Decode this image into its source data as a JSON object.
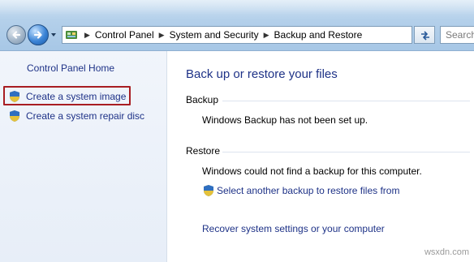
{
  "nav": {
    "back_icon": "back-arrow-icon",
    "forward_icon": "forward-arrow-icon"
  },
  "address": {
    "crumbs": [
      "Control Panel",
      "System and Security",
      "Backup and Restore"
    ]
  },
  "search": {
    "placeholder": "Search"
  },
  "sidebar": {
    "home_label": "Control Panel Home",
    "items": [
      {
        "label": "Create a system image",
        "icon": "uac-shield-icon"
      },
      {
        "label": "Create a system repair disc",
        "icon": "uac-shield-icon"
      }
    ]
  },
  "main": {
    "title": "Back up or restore your files",
    "backup": {
      "heading": "Backup",
      "status": "Windows Backup has not been set up."
    },
    "restore": {
      "heading": "Restore",
      "status": "Windows could not find a backup for this computer.",
      "select_link": "Select another backup to restore files from",
      "recover_link": "Recover system settings or your computer"
    }
  },
  "watermark": "wsxdn.com",
  "colors": {
    "link": "#1e3287",
    "highlight_box": "#a81d22",
    "sidebar_bg": "#e7eef8"
  }
}
